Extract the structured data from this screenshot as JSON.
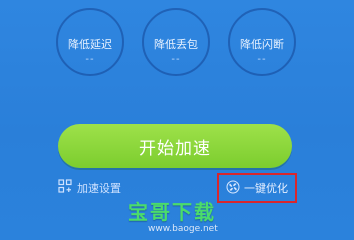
{
  "metrics": [
    {
      "title": "降低延迟",
      "value": "--"
    },
    {
      "title": "降低丢包",
      "value": "--"
    },
    {
      "title": "降低闪断",
      "value": "--"
    }
  ],
  "actions": {
    "start_label": "开始加速",
    "settings_label": "加速设置",
    "optimize_label": "一键优化"
  },
  "watermark": {
    "title": "宝哥下载",
    "url": "www.baoge.net"
  },
  "colors": {
    "background": "#2b82dc",
    "start_button": "#8bd63a",
    "highlight_border": "#d9262c",
    "watermark_text": "#4bdc6b"
  },
  "icons": {
    "settings": "settings-grid-icon",
    "optimize": "fan-icon"
  }
}
